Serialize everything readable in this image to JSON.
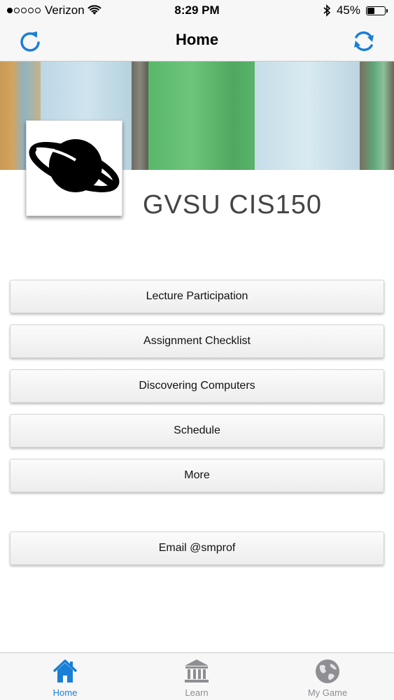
{
  "status_bar": {
    "carrier": "Verizon",
    "time": "8:29 PM",
    "battery": "45%",
    "battery_level": 0.45
  },
  "nav": {
    "title": "Home",
    "left_icon": "refresh-icon",
    "right_icon": "sync-icon"
  },
  "header": {
    "course_title": "GVSU CIS150"
  },
  "menu": {
    "buttons": [
      {
        "label": "Lecture Participation"
      },
      {
        "label": "Assignment Checklist"
      },
      {
        "label": "Discovering Computers"
      },
      {
        "label": "Schedule"
      },
      {
        "label": "More"
      }
    ],
    "email_label": "Email @smprof"
  },
  "tabs": [
    {
      "label": "Home",
      "icon": "house-icon",
      "active": true
    },
    {
      "label": "Learn",
      "icon": "building-icon",
      "active": false
    },
    {
      "label": "My Game",
      "icon": "globe-icon",
      "active": false
    }
  ],
  "colors": {
    "accent": "#1a7fd6",
    "inactive": "#8e8e93"
  }
}
